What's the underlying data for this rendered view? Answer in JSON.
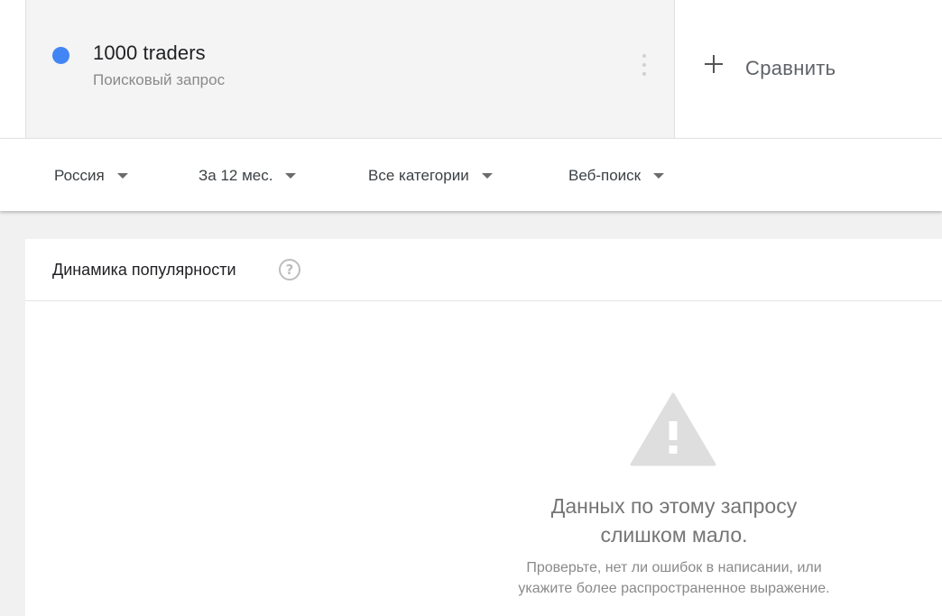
{
  "term": {
    "name": "1000 traders",
    "type": "Поисковый запрос",
    "color": "#4285f4",
    "menu_icon": "more-vert-icon"
  },
  "compare": {
    "icon": "plus-icon",
    "label": "Сравнить"
  },
  "filters": {
    "region": "Россия",
    "period": "За 12 мес.",
    "category": "Все категории",
    "search_type": "Веб-поиск"
  },
  "interest_card": {
    "title": "Динамика популярности",
    "help_icon": "help-circle-icon",
    "help_glyph": "?",
    "empty_icon": "warning-triangle-icon",
    "empty_title_line1": "Данных по этому запросу",
    "empty_title_line2": "слишком мало.",
    "empty_hint_line1": "Проверьте, нет ли ошибок в написании, или",
    "empty_hint_line2": "укажите более распространенное выражение."
  }
}
